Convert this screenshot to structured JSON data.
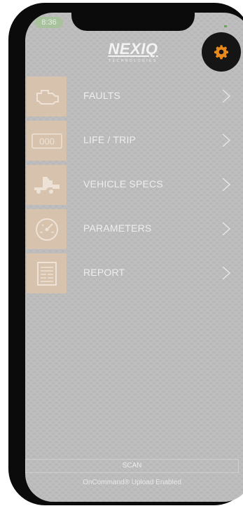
{
  "status_bar": {
    "time": "8:36"
  },
  "logo": {
    "main": "NEXIQ",
    "sub": "TECHNOLOGIES"
  },
  "settings": {
    "icon": "gear-icon",
    "accent_color": "#e8891c"
  },
  "menu": {
    "items": [
      {
        "label": "FAULTS",
        "icon": "engine-icon"
      },
      {
        "label": "LIFE / TRIP",
        "icon": "odometer-icon",
        "icon_text": "000"
      },
      {
        "label": "VEHICLE SPECS",
        "icon": "truck-icon"
      },
      {
        "label": "PARAMETERS",
        "icon": "gauge-icon"
      },
      {
        "label": "REPORT",
        "icon": "report-icon"
      }
    ]
  },
  "footer": {
    "scan_label": "SCAN",
    "oncommand_text": "OnCommand® Upload Enabled"
  }
}
